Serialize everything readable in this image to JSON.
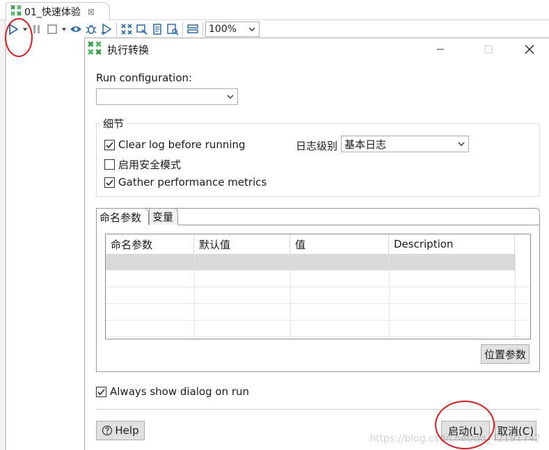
{
  "editor_tab": {
    "label": "01_快速体验",
    "close_glyph": "⊠"
  },
  "toolbar": {
    "icons": [
      "run-icon",
      "run-dropdown-icon",
      "pause-icon",
      "stop-icon",
      "stop-dropdown-icon",
      "preview-icon",
      "debug-icon",
      "replay-icon",
      "verify-icon",
      "impact-icon",
      "sql-icon",
      "explore-db-icon",
      "show-results-icon"
    ],
    "zoom_value": "100%"
  },
  "dialog": {
    "title": "执行转换",
    "run_configuration_label": "Run configuration:",
    "run_configuration_value": "",
    "details_group_title": "细节",
    "clear_log_label": "Clear log before running",
    "clear_log_checked": true,
    "safe_mode_label": "启用安全模式",
    "safe_mode_checked": false,
    "gather_metrics_label": "Gather performance metrics",
    "gather_metrics_checked": true,
    "log_level_label": "日志级别",
    "log_level_value": "基本日志",
    "tabs": [
      "命名参数",
      "变量"
    ],
    "table_headers": [
      "命名参数",
      "默认值",
      "值",
      "Description"
    ],
    "position_params_button": "位置参数",
    "always_show_label": "Always show dialog on run",
    "always_show_checked": true,
    "help_button": "Help",
    "launch_button": "启动(L)",
    "cancel_button": "取消(C)"
  },
  "watermark": "https://blog.csdn.net/qq_42191742",
  "colors": {
    "annotation": "#e8161b",
    "kettle_green": "#2e9e44",
    "toolbar_blue": "#2a6bb0"
  }
}
